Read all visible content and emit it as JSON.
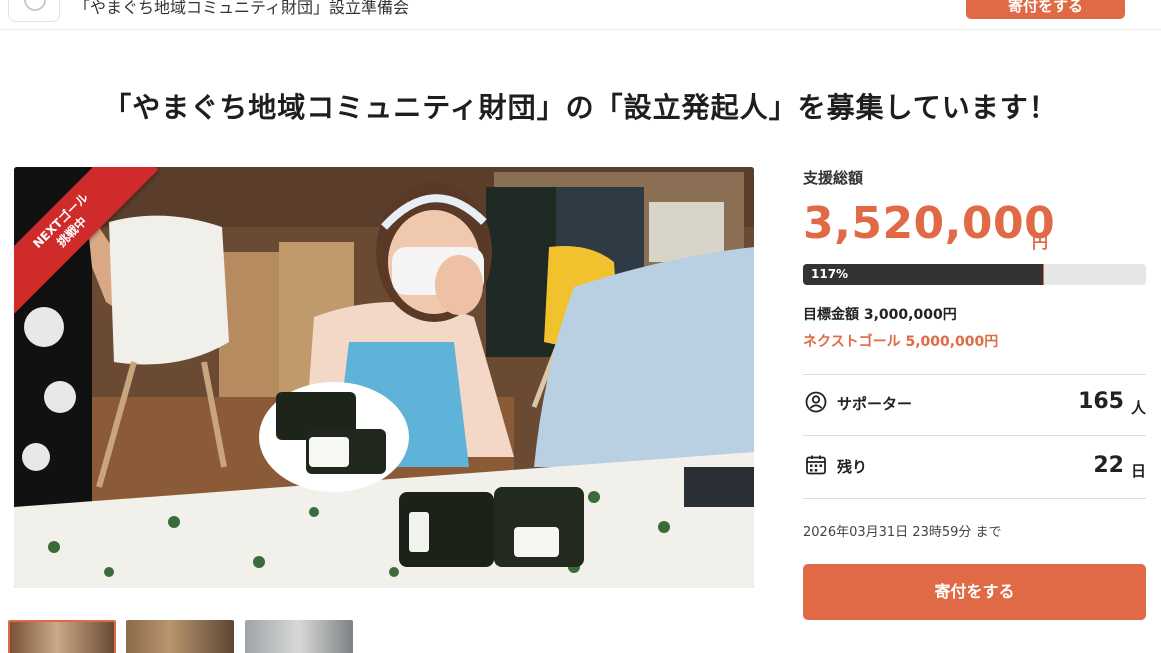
{
  "header": {
    "org_name": "「やまぐち地域コミュニティ財団」設立準備会",
    "cta_label": "寄付をする"
  },
  "page": {
    "title": "「やまぐち地域コミュニティ財団」の「設立発起人」を募集しています！"
  },
  "hero": {
    "ribbon_line1": "NEXTゴール",
    "ribbon_line2": "挑戦中"
  },
  "stats": {
    "total_label": "支援総額",
    "total_amount": "3,520,000",
    "total_unit": "円",
    "progress_label": "117%",
    "goal_progress_fraction": 0.7,
    "next_goal_progress_fraction": 0.704,
    "goal_text": "目標金額 3,000,000円",
    "next_goal_text": "ネクストゴール 5,000,000円",
    "supporters_label": "サポーター",
    "supporters_value": "165",
    "supporters_unit": "人",
    "remaining_label": "残り",
    "remaining_value": "22",
    "remaining_unit": "日",
    "deadline": "2026年03月31日 23時59分 まで",
    "donate_label": "寄付をする"
  },
  "icons": {
    "supporters": "person-circle-icon",
    "remaining": "calendar-icon"
  },
  "colors": {
    "accent": "#e06a45",
    "progress_dark": "#333333",
    "ribbon": "#cf2b2b"
  }
}
